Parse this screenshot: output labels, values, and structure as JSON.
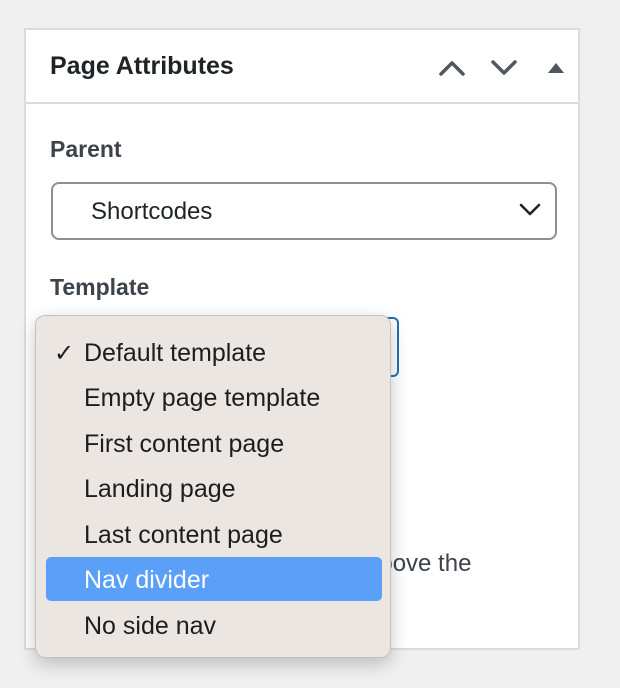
{
  "panel": {
    "title": "Page Attributes",
    "move_up_icon": "chevron-up-icon",
    "move_down_icon": "chevron-down-icon",
    "toggle_icon": "triangle-up-icon"
  },
  "parent": {
    "label": "Parent",
    "value": "Shortcodes"
  },
  "template": {
    "label": "Template",
    "options": [
      {
        "label": "Default template",
        "checked": true,
        "highlighted": false
      },
      {
        "label": "Empty page template",
        "checked": false,
        "highlighted": false
      },
      {
        "label": "First content page",
        "checked": false,
        "highlighted": false
      },
      {
        "label": "Landing page",
        "checked": false,
        "highlighted": false
      },
      {
        "label": "Last content page",
        "checked": false,
        "highlighted": false
      },
      {
        "label": "Nav divider",
        "checked": false,
        "highlighted": true
      },
      {
        "label": "No side nav",
        "checked": false,
        "highlighted": false
      }
    ],
    "check_glyph": "✓"
  },
  "order_hint": {
    "visible_fragment": "above the"
  },
  "colors": {
    "highlight": "#5aa0f8",
    "focus_border": "#2271b1"
  }
}
